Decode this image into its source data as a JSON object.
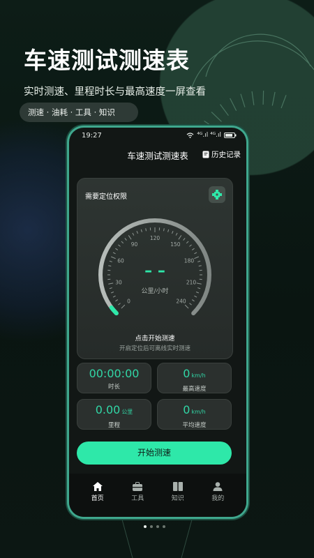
{
  "hero": {
    "title": "车速测试测速表",
    "subtitle": "实时测速、里程时长与最高速度一屏查看",
    "chip": "测速 · 油耗 · 工具 · 知识"
  },
  "status_bar": {
    "time": "19:27",
    "signal_text": "⁴ᴳ.ıl ⁴ᴳ.ıl"
  },
  "app": {
    "title": "车速测试测速表",
    "history_label": "历史记录"
  },
  "gauge": {
    "permission_label": "需要定位权限",
    "reading": "– –",
    "unit_label": "公里/小时",
    "ticks": [
      "0",
      "30",
      "60",
      "90",
      "120",
      "150",
      "180",
      "210",
      "240"
    ],
    "start_hint": "点击开始测速",
    "start_sub": "开启定位后可离线实时测速"
  },
  "stats": {
    "duration": {
      "value": "00:00:00",
      "label": "时长"
    },
    "max_speed": {
      "value": "0",
      "unit": "km/h",
      "label": "最高速度"
    },
    "distance": {
      "value": "0.00",
      "unit": "公里",
      "label": "里程"
    },
    "avg_speed": {
      "value": "0",
      "unit": "km/h",
      "label": "平均速度"
    }
  },
  "start_button": "开始测速",
  "tabs": [
    {
      "label": "首页",
      "icon": "home-icon"
    },
    {
      "label": "工具",
      "icon": "toolbox-icon"
    },
    {
      "label": "知识",
      "icon": "book-icon"
    },
    {
      "label": "我的",
      "icon": "user-icon"
    }
  ],
  "colors": {
    "accent": "#2ee8a9",
    "accent_text": "#31d6a6",
    "frame": "#3fa78d"
  }
}
